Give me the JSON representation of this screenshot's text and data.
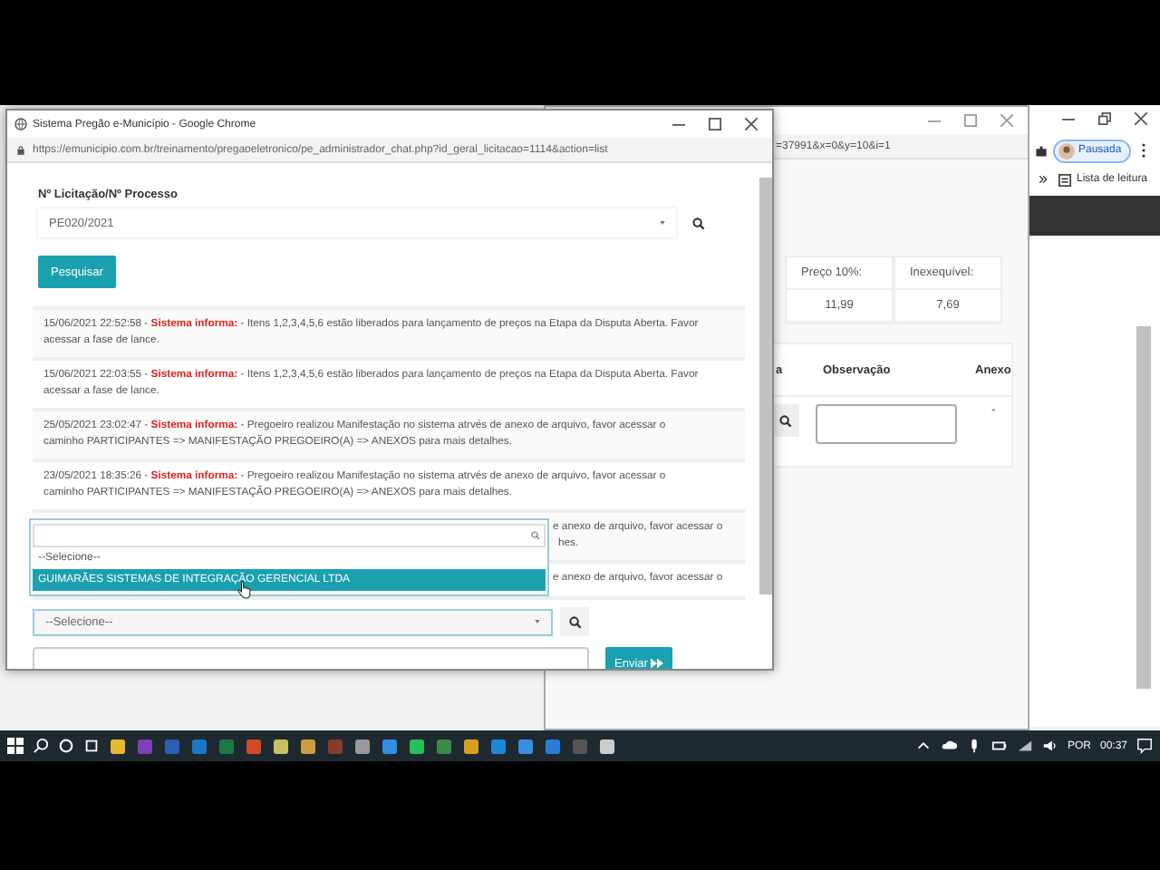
{
  "popup_window": {
    "title": "Sistema Pregão e-Município - Google Chrome",
    "url": "https://emunicipio.com.br/treinamento/pregaoeletronico/pe_administrador_chat.php?id_geral_licitacao=1114&action=list",
    "form": {
      "label": "Nº Licitação/Nº Processo",
      "select_value": "PE020/2021",
      "search_button": "Pesquisar"
    },
    "messages": [
      {
        "kind": "full",
        "timestamp": "15/06/2021 22:52:58 -",
        "sender": "Sistema informa:",
        "text": "- Itens 1,2,3,4,5,6 estão liberados para lançamento de preços na Etapa da Disputa Aberta. Favor acessar a fase de lance."
      },
      {
        "kind": "full",
        "timestamp": "15/06/2021 22:03:55 -",
        "sender": "Sistema informa:",
        "text": "- Itens 1,2,3,4,5,6 estão liberados para lançamento de preços na Etapa da Disputa Aberta. Favor acessar a fase de lance."
      },
      {
        "kind": "full",
        "timestamp": "25/05/2021 23:02:47 -",
        "sender": "Sistema informa:",
        "text": "- Pregoeiro realizou Manifestação no sistema atrvés de anexo de arquivo, favor acessar o caminho PARTICIPANTES => MANIFESTAÇÃO PREGOEIRO(A) => ANEXOS para mais detalhes."
      },
      {
        "kind": "full",
        "timestamp": "23/05/2021 18:35:26 -",
        "sender": "Sistema informa:",
        "text": "- Pregoeiro realizou Manifestação no sistema atrvés de anexo de arquivo, favor acessar o caminho PARTICIPANTES => MANIFESTAÇÃO PREGOEIRO(A) => ANEXOS para mais detalhes."
      },
      {
        "kind": "partial",
        "lines": [
          "e anexo de arquivo, favor acessar o",
          "hes."
        ]
      },
      {
        "kind": "partial",
        "lines": [
          "e anexo de arquivo, favor acessar o"
        ]
      }
    ],
    "dropdown": {
      "options": [
        {
          "label": "--Selecione--",
          "selected": false
        },
        {
          "label": "GUIMARÃES SISTEMAS DE INTEGRAÇÃO GERENCIAL LTDA",
          "selected": true
        }
      ]
    },
    "recipient_select": {
      "value": "--Selecione--"
    },
    "send_button": "Enviar"
  },
  "background_window": {
    "url": "=37991&x=0&y=10&i=1",
    "price_table": {
      "columns": [
        "Preço 10%:",
        "Inexequível:"
      ],
      "values": [
        "11,99",
        "7,69"
      ]
    },
    "items_table": {
      "columns": [
        "a",
        "Observação",
        "Anexo"
      ],
      "anexo": "-"
    }
  },
  "main_window": {
    "profile_label": "Pausada",
    "bookmark": "Lista de leitura"
  },
  "taskbar": {
    "language": "POR",
    "time": "00:37"
  }
}
